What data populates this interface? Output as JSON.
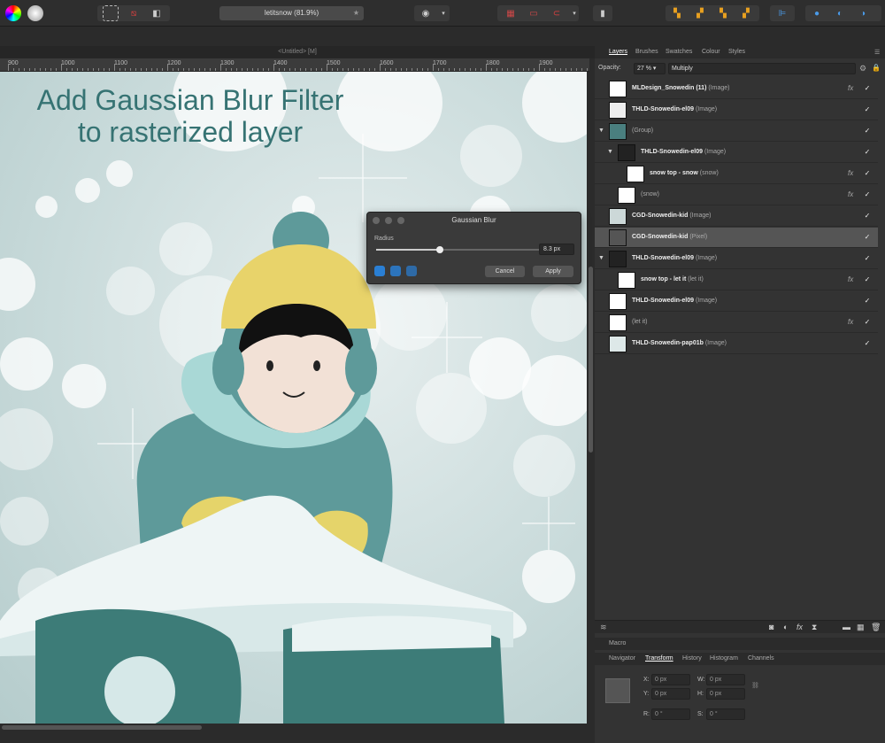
{
  "document": {
    "title": "letitsnow (81.9%)",
    "tab": "<Untitled> [M]"
  },
  "ruler": {
    "labels": [
      "900",
      "1000",
      "1100",
      "1200",
      "1300",
      "1400",
      "1500",
      "1600",
      "1700",
      "1800",
      "1900"
    ]
  },
  "canvas": {
    "headline_line1": "Add Gaussian Blur Filter",
    "headline_line2": "to rasterized layer"
  },
  "dialog": {
    "title": "Gaussian Blur",
    "radius_label": "Radius",
    "radius_value": "8.3 px",
    "slider_fraction": 0.39,
    "cancel": "Cancel",
    "apply": "Apply"
  },
  "panel": {
    "tabs": [
      "Layers",
      "Brushes",
      "Swatches",
      "Colour",
      "Styles"
    ],
    "opacity_label": "Opacity:",
    "opacity_value": "27 %",
    "blend_mode": "Multiply",
    "layers": [
      {
        "name": "MLDesign_Snowedin (11)",
        "type": "(Image)",
        "fx": true,
        "indent": 0,
        "tri": ""
      },
      {
        "name": "THLD-Snowedin-el09",
        "type": "(Image)",
        "fx": false,
        "indent": 0,
        "tri": ""
      },
      {
        "name": "",
        "type": "(Group)",
        "fx": false,
        "indent": 0,
        "tri": "▼"
      },
      {
        "name": "THLD-Snowedin-el09",
        "type": "(Image)",
        "fx": false,
        "indent": 1,
        "tri": "▼"
      },
      {
        "name": "snow top - snow",
        "type": "(snow)",
        "fx": true,
        "indent": 2,
        "tri": ""
      },
      {
        "name": "",
        "type": "(snow)",
        "fx": true,
        "indent": 1,
        "tri": ""
      },
      {
        "name": "CGD-Snowedin-kid",
        "type": "(Image)",
        "fx": false,
        "indent": 0,
        "tri": ""
      },
      {
        "name": "CGD-Snowedin-kid",
        "type": "(Pixel)",
        "fx": false,
        "indent": 0,
        "tri": "",
        "selected": true
      },
      {
        "name": "THLD-Snowedin-el09",
        "type": "(Image)",
        "fx": false,
        "indent": 0,
        "tri": "▼"
      },
      {
        "name": "snow top - let it",
        "type": "(let it)",
        "fx": true,
        "indent": 1,
        "tri": ""
      },
      {
        "name": "THLD-Snowedin-el09",
        "type": "(Image)",
        "fx": false,
        "indent": 0,
        "tri": ""
      },
      {
        "name": "",
        "type": "(let it)",
        "fx": true,
        "indent": 0,
        "tri": ""
      },
      {
        "name": "THLD-Snowedin-pap01b",
        "type": "(Image)",
        "fx": false,
        "indent": 0,
        "tri": ""
      }
    ],
    "macro_label": "Macro",
    "bottom_tabs": [
      "Navigator",
      "Transform",
      "History",
      "Histogram",
      "Channels"
    ],
    "transform": {
      "x_label": "X:",
      "x": "0 px",
      "y_label": "Y:",
      "y": "0 px",
      "w_label": "W:",
      "w": "0 px",
      "h_label": "H:",
      "h": "0 px",
      "r_label": "R:",
      "r": "0 °",
      "s_label": "S:",
      "s": "0 °"
    }
  }
}
